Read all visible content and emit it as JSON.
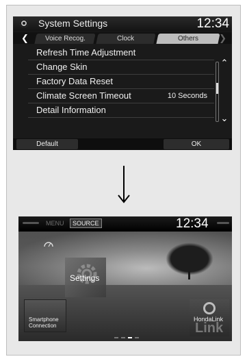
{
  "settings_screen": {
    "title": "System Settings",
    "clock": "12:34",
    "tabs": [
      {
        "label": "Voice Recog."
      },
      {
        "label": "Clock"
      },
      {
        "label": "Others"
      }
    ],
    "items": [
      {
        "label": "Refresh Time Adjustment",
        "value": ""
      },
      {
        "label": "Change Skin",
        "value": ""
      },
      {
        "label": "Factory Data Reset",
        "value": ""
      },
      {
        "label": "Climate Screen Timeout",
        "value": "10 Seconds"
      },
      {
        "label": "Detail Information",
        "value": ""
      }
    ],
    "footer": {
      "default_label": "Default",
      "ok_label": "OK"
    }
  },
  "home_screen": {
    "menu_label": "MENU",
    "source_label": "SOURCE",
    "clock": "12:34",
    "settings_label": "Settings",
    "smartphone_label": "Smartphone Connection",
    "hondalink_label": "HondaLink",
    "link_watermark": "Link"
  },
  "colors": {
    "screen_background": "#1a1a1a",
    "active_tab": "#bdbdbd"
  }
}
